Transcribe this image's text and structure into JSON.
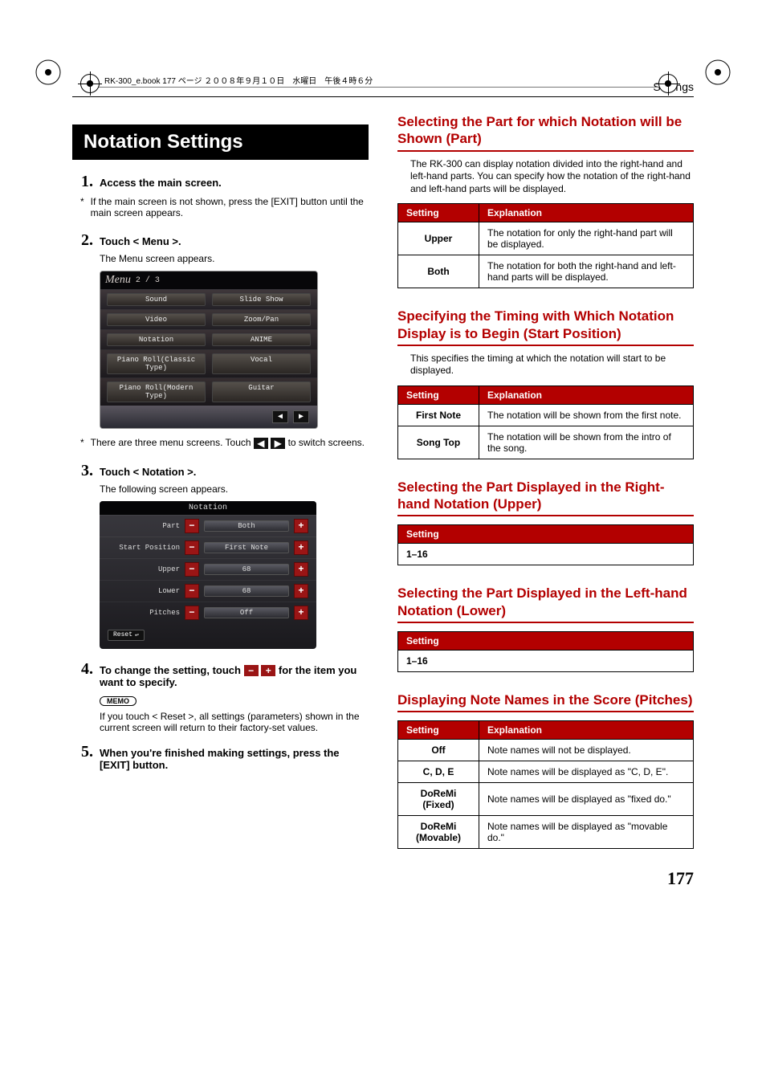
{
  "running_head": "Settings",
  "header_meta": "RK-300_e.book  177 ページ  ２００８年９月１０日　水曜日　午後４時６分",
  "title": "Notation Settings",
  "steps": {
    "s1": {
      "num": "1.",
      "text": "Access the main screen."
    },
    "s1_note": "If the main screen is not shown, press the [EXIT] button until the main screen appears.",
    "s2": {
      "num": "2.",
      "text": "Touch < Menu >."
    },
    "s2_caption": "The Menu screen appears.",
    "menu_nav_note_before": "There are three menu screens. Touch ",
    "menu_nav_note_after": " to switch screens.",
    "s3": {
      "num": "3.",
      "text": "Touch < Notation >."
    },
    "s3_caption": "The following screen appears.",
    "s4": {
      "num": "4.",
      "before": "To change the setting, touch ",
      "after": " for the item you want to specify."
    },
    "memo_label": "MEMO",
    "memo_body": "If you touch < Reset >, all settings (parameters) shown in the current screen will return to their factory-set values.",
    "s5": {
      "num": "5.",
      "text": "When you're finished making settings, press the [EXIT] button."
    }
  },
  "menu_screen": {
    "title": "Menu",
    "page_indicator": "2 / 3",
    "rows": [
      [
        "Sound",
        "Slide Show"
      ],
      [
        "Video",
        "Zoom/Pan"
      ],
      [
        "Notation",
        "ANIME"
      ],
      [
        "Piano Roll(Classic Type)",
        "Vocal"
      ],
      [
        "Piano Roll(Modern Type)",
        "Guitar"
      ]
    ],
    "prev_glyph": "◀",
    "next_glyph": "▶"
  },
  "notation_screen": {
    "title": "Notation",
    "rows": [
      {
        "label": "Part",
        "value": "Both"
      },
      {
        "label": "Start Position",
        "value": "First Note"
      },
      {
        "label": "Upper",
        "value": "68"
      },
      {
        "label": "Lower",
        "value": "68"
      },
      {
        "label": "Pitches",
        "value": "Off"
      }
    ],
    "minus_glyph": "−",
    "plus_glyph": "+",
    "reset_label": "Reset",
    "reset_icon": "↩"
  },
  "right": {
    "sec1": {
      "heading": "Selecting the Part for which Notation will be Shown (Part)",
      "intro": "The RK-300 can display notation divided into the right-hand and left-hand parts. You can specify how the notation of the right-hand and left-hand parts will be displayed.",
      "table": {
        "h1": "Setting",
        "h2": "Explanation",
        "rows": [
          {
            "k": "Upper",
            "v": "The notation for only the right-hand part will be displayed."
          },
          {
            "k": "Both",
            "v": "The notation for both the right-hand and left-hand parts will be displayed."
          }
        ]
      }
    },
    "sec2": {
      "heading": "Specifying the Timing with Which Notation Display is to Begin (Start Position)",
      "intro": "This specifies the timing at which the notation will start to be displayed.",
      "table": {
        "h1": "Setting",
        "h2": "Explanation",
        "rows": [
          {
            "k": "First Note",
            "v": "The notation will be shown from the first note."
          },
          {
            "k": "Song Top",
            "v": "The notation will be shown from the intro of the song."
          }
        ]
      }
    },
    "sec3": {
      "heading": "Selecting the Part Displayed in the Right-hand Notation (Upper)",
      "table": {
        "h1": "Setting",
        "rows": [
          {
            "k": "1–16"
          }
        ]
      }
    },
    "sec4": {
      "heading": "Selecting the Part Displayed in the Left-hand Notation (Lower)",
      "table": {
        "h1": "Setting",
        "rows": [
          {
            "k": "1–16"
          }
        ]
      }
    },
    "sec5": {
      "heading": "Displaying Note Names in the Score (Pitches)",
      "table": {
        "h1": "Setting",
        "h2": "Explanation",
        "rows": [
          {
            "k": "Off",
            "v": "Note names will not be displayed."
          },
          {
            "k": "C, D, E",
            "v": "Note names will be displayed as \"C, D, E\"."
          },
          {
            "k": "DoReMi (Fixed)",
            "v": "Note names will be displayed as \"fixed do.\""
          },
          {
            "k": "DoReMi (Movable)",
            "v": "Note names will be displayed as \"movable do.\""
          }
        ]
      }
    }
  },
  "page_number": "177"
}
